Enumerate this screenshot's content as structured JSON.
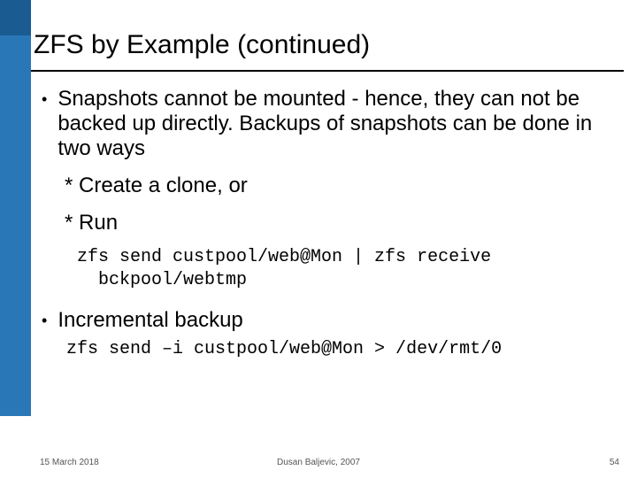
{
  "title": "ZFS by Example (continued)",
  "bullets": [
    {
      "text": "Snapshots cannot be mounted - hence, they can not be backed up directly. Backups of snapshots can be done in two ways",
      "stars": [
        "* Create a clone, or",
        "* Run"
      ],
      "code": "zfs send custpool/web@Mon | zfs receive\n  bckpool/webtmp"
    },
    {
      "text": "Incremental backup",
      "code": "zfs send –i custpool/web@Mon > /dev/rmt/0"
    }
  ],
  "footer": {
    "date": "15 March 2018",
    "author": "Dusan Baljevic, 2007",
    "page": "54"
  }
}
